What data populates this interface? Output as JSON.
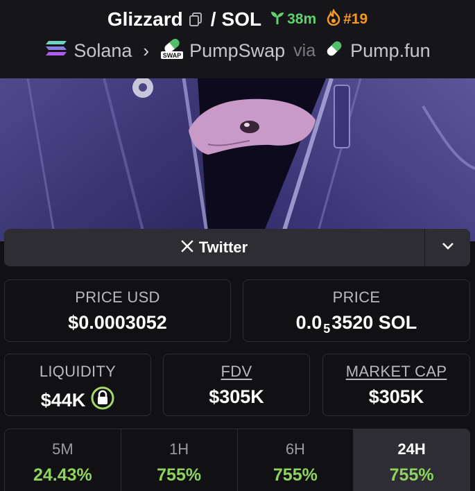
{
  "header": {
    "token_name": "Glizzard",
    "separator": "/",
    "quote_symbol": "SOL",
    "age": "38m",
    "rank": "#19",
    "chain": "Solana",
    "dex": "PumpSwap",
    "dex_badge": "SWAP",
    "via_text": "via",
    "launchpad": "Pump.fun"
  },
  "socials": {
    "twitter_label": "Twitter"
  },
  "price": {
    "usd_label": "PRICE USD",
    "usd_value": "$0.0003052",
    "native_label": "PRICE",
    "native_prefix": "0.0",
    "native_zeros": "5",
    "native_suffix": "3520 SOL"
  },
  "stats": {
    "liquidity_label": "LIQUIDITY",
    "liquidity_value": "$44K",
    "fdv_label": "FDV",
    "fdv_value": "$305K",
    "mcap_label": "MARKET CAP",
    "mcap_value": "$305K"
  },
  "periods": [
    {
      "label": "5M",
      "value": "24.43%"
    },
    {
      "label": "1H",
      "value": "755%"
    },
    {
      "label": "6H",
      "value": "755%"
    },
    {
      "label": "24H",
      "value": "755%"
    }
  ],
  "colors": {
    "age_green": "#5fd36a",
    "rank_orange": "#f59a23",
    "positive_green": "#8fd35f",
    "liquidity_lock": "#a6d86a"
  }
}
